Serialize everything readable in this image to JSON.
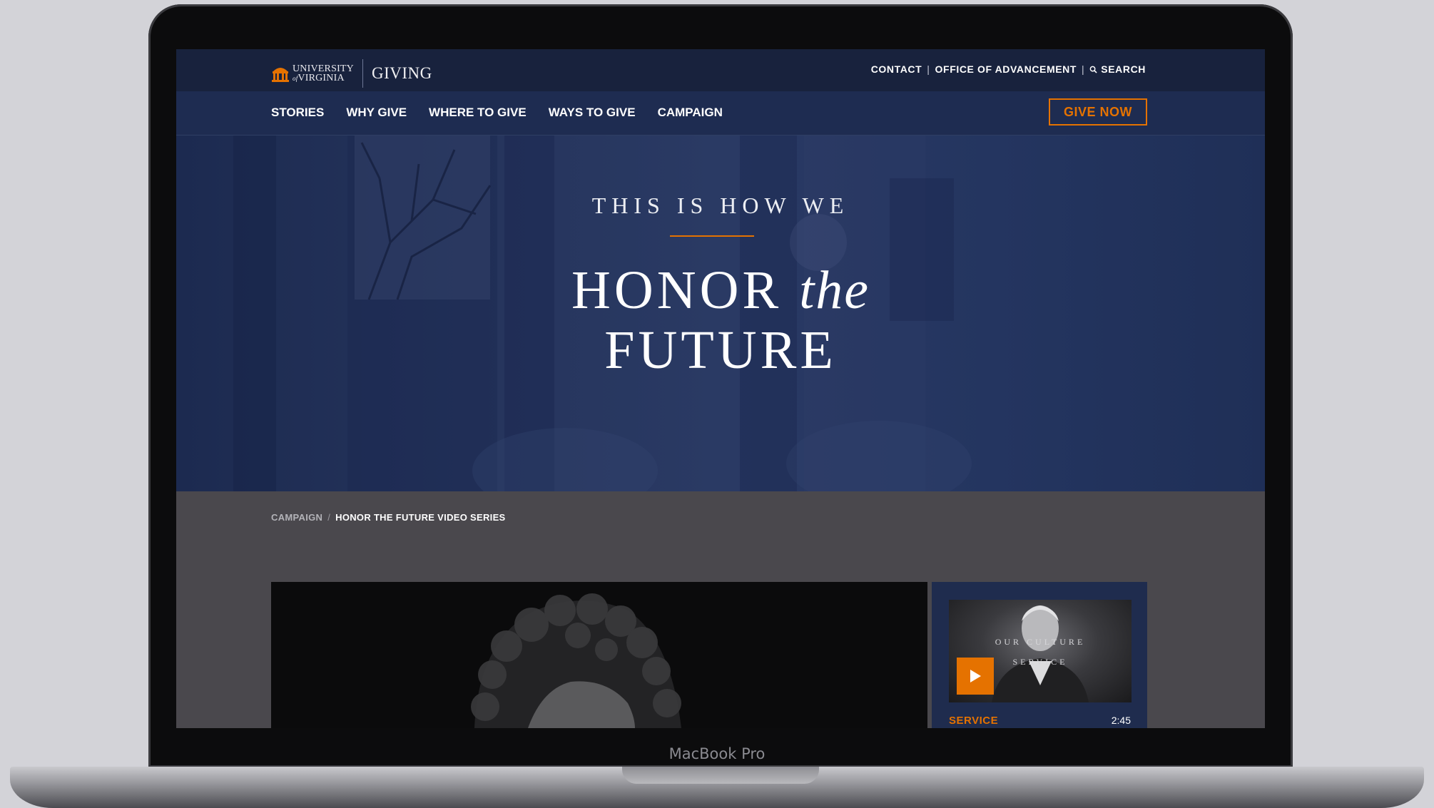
{
  "device": {
    "label": "MacBook Pro"
  },
  "header": {
    "logo_line1": "UNIVERSITY",
    "logo_line2": "VIRGINIA",
    "logo_of": "of",
    "site_name": "GIVING",
    "utility_links": [
      "CONTACT",
      "OFFICE OF ADVANCEMENT"
    ],
    "search_label": "SEARCH"
  },
  "nav": {
    "items": [
      "STORIES",
      "WHY GIVE",
      "WHERE TO GIVE",
      "WAYS TO GIVE",
      "CAMPAIGN"
    ],
    "cta_label": "GIVE NOW"
  },
  "hero": {
    "kicker": "THIS IS HOW WE",
    "title_part1": "HONOR",
    "title_part2": "the",
    "title_part3": "FUTURE"
  },
  "breadcrumb": {
    "parent": "CAMPAIGN",
    "current": "HONOR THE FUTURE VIDEO SERIES"
  },
  "video_card": {
    "thumb_line1": "OUR CULTURE",
    "thumb_line2": "SERVICE",
    "category": "SERVICE",
    "duration": "2:45"
  },
  "colors": {
    "accent_orange": "#e57200",
    "navy": "#1e2c51",
    "topbar": "#18223d"
  },
  "icons": [
    "rotunda-logo-icon",
    "search-icon",
    "play-icon"
  ]
}
